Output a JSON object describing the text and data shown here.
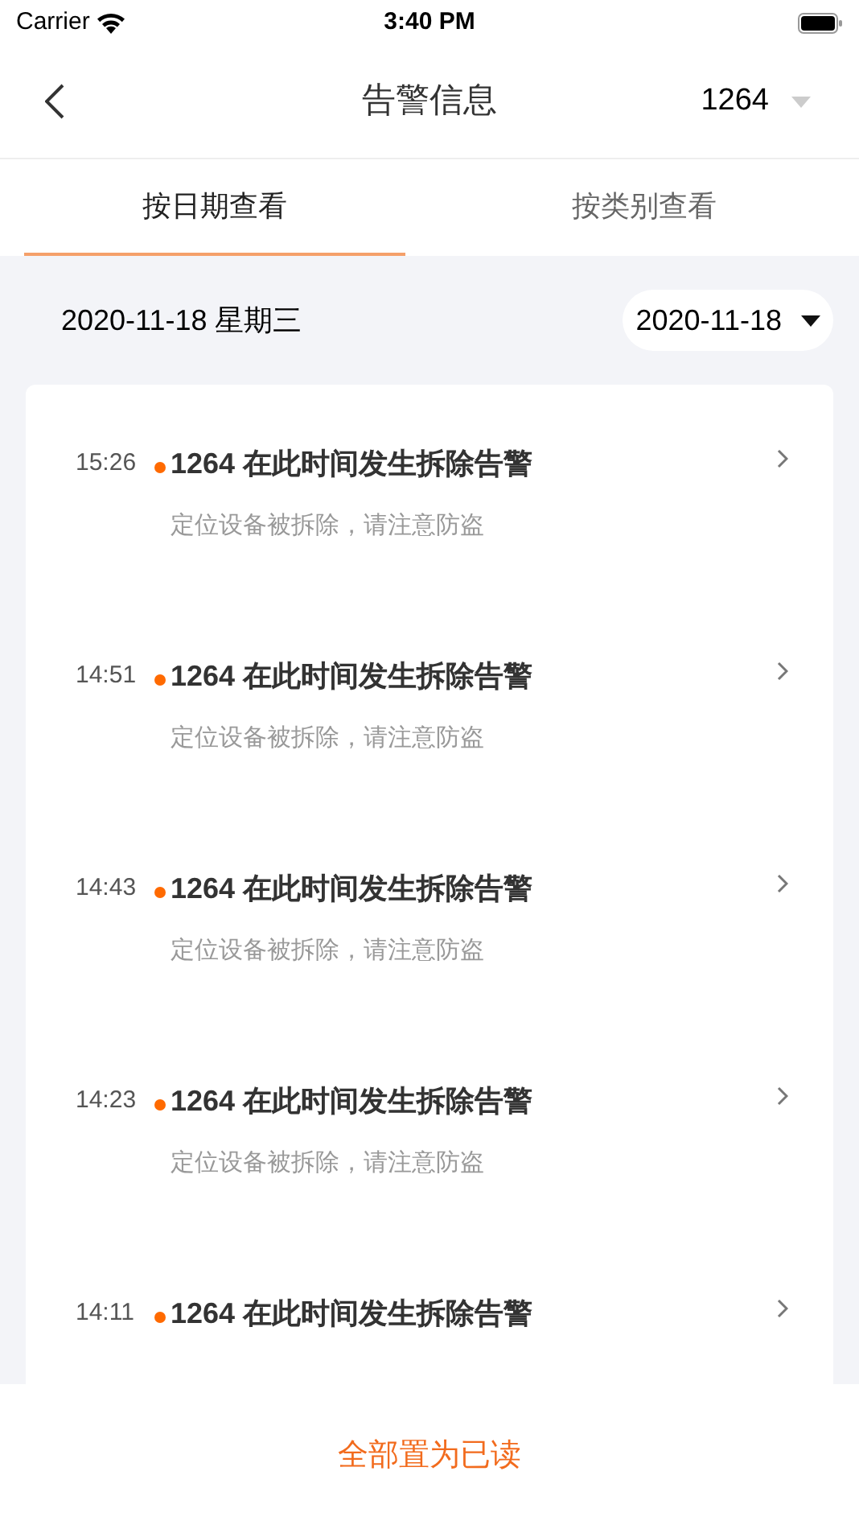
{
  "status_bar": {
    "carrier": "Carrier",
    "time": "3:40 PM"
  },
  "nav": {
    "title": "告警信息",
    "device": "1264"
  },
  "tabs": [
    {
      "label": "按日期查看",
      "selected": true
    },
    {
      "label": "按类别查看",
      "selected": false
    }
  ],
  "date_bar": {
    "date_label": "2020-11-18 星期三",
    "picker": "2020-11-18"
  },
  "alerts": [
    {
      "time": "15:26",
      "unread": true,
      "title": "1264 在此时间发生拆除告警",
      "message": "定位设备被拆除，请注意防盗"
    },
    {
      "time": "14:51",
      "unread": true,
      "title": "1264 在此时间发生拆除告警",
      "message": "定位设备被拆除，请注意防盗"
    },
    {
      "time": "14:43",
      "unread": true,
      "title": "1264 在此时间发生拆除告警",
      "message": "定位设备被拆除，请注意防盗"
    },
    {
      "time": "14:23",
      "unread": true,
      "title": "1264 在此时间发生拆除告警",
      "message": "定位设备被拆除，请注意防盗"
    },
    {
      "time": "14:11",
      "unread": true,
      "title": "1264 在此时间发生拆除告警"
    }
  ],
  "footer_button": "全部置为已读"
}
